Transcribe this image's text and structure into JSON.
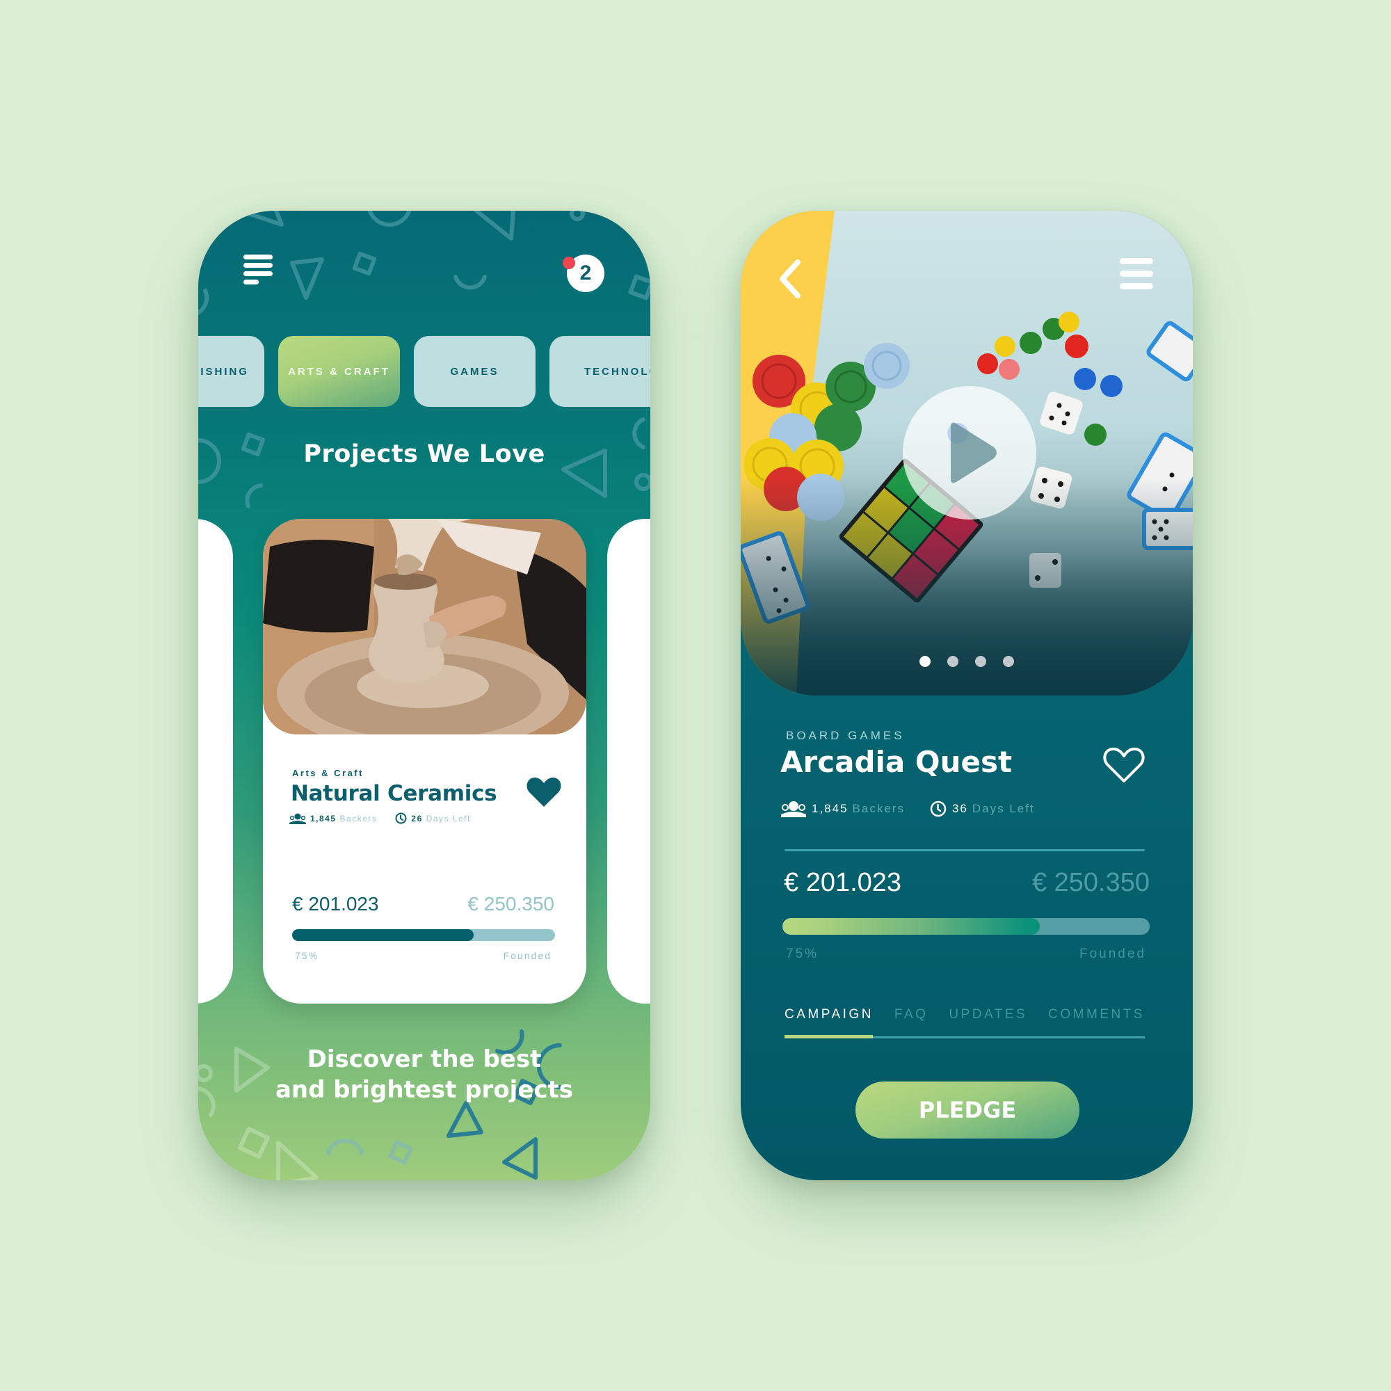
{
  "colors": {
    "background": "#dbefd5",
    "primary_teal": "#0b5f6c",
    "accent_green": "#b5d97f",
    "notification_red": "#ef4452"
  },
  "discover_screen": {
    "menu_icon": "menu-lines-icon",
    "notification_count": "2",
    "categories": [
      {
        "label": "PUBLISHING",
        "visible_label": "BLISHING",
        "active": false
      },
      {
        "label": "ARTS & CRAFT",
        "active": true
      },
      {
        "label": "GAMES",
        "active": false
      },
      {
        "label": "TECHNOLOGY",
        "visible_label": "TECHNOLO",
        "active": false
      }
    ],
    "section_title": "Projects We Love",
    "featured_project": {
      "image": "pottery-wheel-photo",
      "category": "Arts & Craft",
      "title": "Natural Ceramics",
      "favorited": true,
      "backers_count": "1,845",
      "backers_label": "Backers",
      "days_count": "26",
      "days_label": "Days Left",
      "raised": "€ 201.023",
      "goal": "€ 250.350",
      "progress_percent": 69,
      "percent_label": "75%",
      "status_label": "Founded"
    },
    "tagline_line1": "Discover the best",
    "tagline_line2": "and brightest projects"
  },
  "detail_screen": {
    "back_icon": "chevron-left-icon",
    "menu_icon": "hamburger-icon",
    "hero_image": "board-game-pieces-photo",
    "carousel": {
      "total": 4,
      "active_index": 0
    },
    "category": "BOARD GAMES",
    "title": "Arcadia Quest",
    "favorited": false,
    "backers_count": "1,845",
    "backers_label": "Backers",
    "days_count": "36",
    "days_label": "Days Left",
    "raised": "€ 201.023",
    "goal": "€ 250.350",
    "progress_percent": 70,
    "percent_label": "75%",
    "status_label": "Founded",
    "tabs": [
      {
        "label": "CAMPAIGN",
        "active": true
      },
      {
        "label": "FAQ",
        "active": false
      },
      {
        "label": "UPDATES",
        "active": false
      },
      {
        "label": "COMMENTS",
        "active": false
      }
    ],
    "cta_label": "PLEDGE"
  }
}
